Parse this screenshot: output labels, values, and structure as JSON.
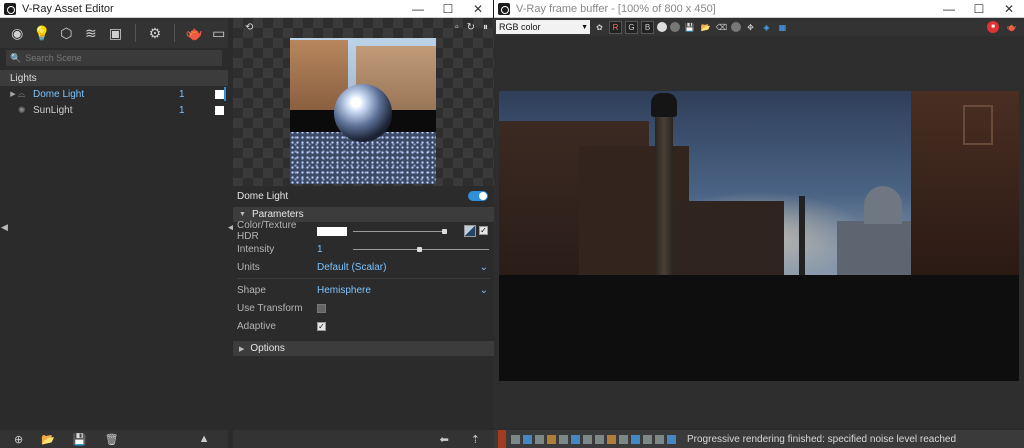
{
  "asset_editor": {
    "title": "V-Ray Asset Editor",
    "window_buttons": [
      "—",
      "☐",
      "✕"
    ],
    "toolbar_icons": [
      "materials-icon",
      "lights-icon",
      "geometry-icon",
      "render-elements-icon",
      "textures-icon",
      "settings-icon",
      "render-icon",
      "frame-buffer-icon"
    ],
    "search_placeholder": "Search Scene",
    "section_label": "Lights",
    "lights": [
      {
        "name": "Dome Light",
        "count": "1",
        "selected": true
      },
      {
        "name": "SunLight",
        "count": "1",
        "selected": false
      }
    ],
    "preview_icons": [
      "pin-icon",
      "window-icon",
      "refresh-icon",
      "pause-icon"
    ],
    "params": {
      "light_name": "Dome Light",
      "group_parameters": "Parameters",
      "color_label": "Color/Texture HDR",
      "intensity_label": "Intensity",
      "intensity_value": "1",
      "units_label": "Units",
      "units_value": "Default (Scalar)",
      "shape_label": "Shape",
      "shape_value": "Hemisphere",
      "use_transform_label": "Use Transform",
      "use_transform_checked": false,
      "adaptive_label": "Adaptive",
      "adaptive_checked": true,
      "group_options": "Options"
    }
  },
  "frame_buffer": {
    "title": "V-Ray frame buffer - [100% of 800 x 450]",
    "window_buttons": [
      "—",
      "☐",
      "✕"
    ],
    "channel_select": "RGB color",
    "channels": [
      "R",
      "G",
      "B"
    ],
    "status_message": "Progressive rendering finished: specified noise level reached"
  }
}
